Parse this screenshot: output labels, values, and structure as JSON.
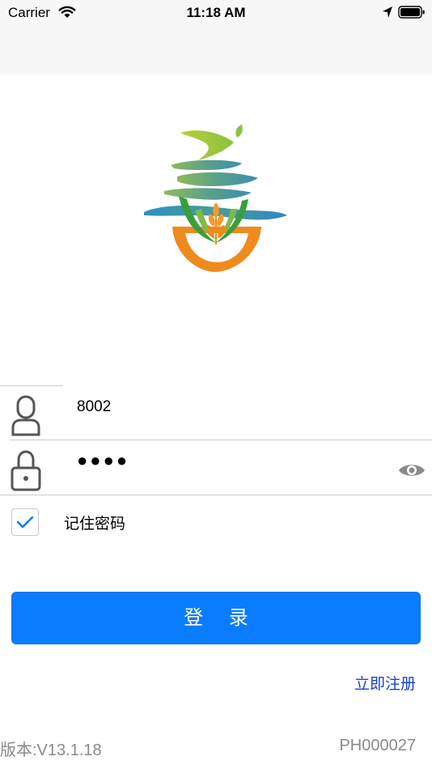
{
  "status_bar": {
    "carrier": "Carrier",
    "time": "11:18 AM"
  },
  "login_form": {
    "username": "8002",
    "password_mask": "●●●●",
    "remember_label": "记住密码",
    "remember_checked": true,
    "login_label": "登 录",
    "register_label": "立即注册"
  },
  "footer": {
    "version": "版本:V13.1.18",
    "device_id": "PH000027"
  },
  "colors": {
    "primary": "#0a7cff",
    "link": "#1b3fd1",
    "footer_text": "#8a8a8a"
  },
  "icons": [
    "wifi-icon",
    "location-arrow-icon",
    "battery-icon",
    "user-icon",
    "lock-icon",
    "eye-icon",
    "check-icon"
  ]
}
